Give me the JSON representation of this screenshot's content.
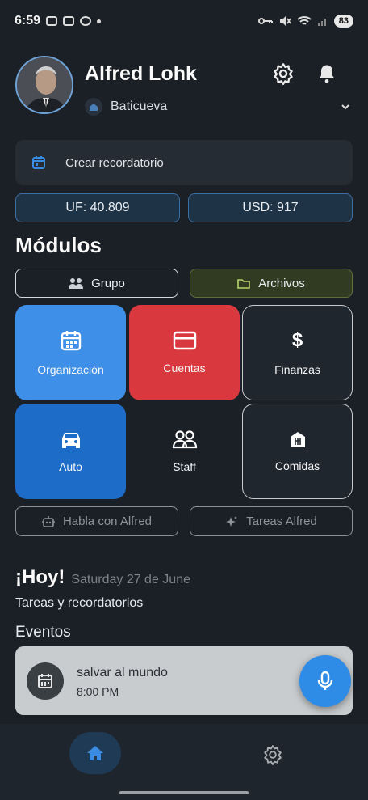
{
  "status_bar": {
    "time": "6:59",
    "battery": "83"
  },
  "profile": {
    "name": "Alfred Lohk",
    "location": "Baticueva"
  },
  "reminder": {
    "label": "Crear recordatorio"
  },
  "rates": {
    "uf": "UF: 40.809",
    "usd": "USD: 917"
  },
  "modules": {
    "title": "Módulos",
    "tabs": [
      {
        "label": "Grupo",
        "icon": "group-icon"
      },
      {
        "label": "Archivos",
        "icon": "folder-icon"
      }
    ],
    "tiles": [
      {
        "label": "Organización",
        "icon": "calendar-icon",
        "color": "#3d8fe8"
      },
      {
        "label": "Cuentas",
        "icon": "credit-card-icon",
        "color": "#d9393e"
      },
      {
        "label": "Finanzas",
        "icon": "dollar-icon",
        "color": "#20262d"
      },
      {
        "label": "Auto",
        "icon": "car-icon",
        "color": "#1d6cc8"
      },
      {
        "label": "Staff",
        "icon": "people-icon",
        "color": "#1b2026"
      },
      {
        "label": "Comidas",
        "icon": "restaurant-icon",
        "color": "#20262d"
      }
    ],
    "actions": [
      {
        "label": "Habla con Alfred",
        "icon": "robot-icon"
      },
      {
        "label": "Tareas Alfred",
        "icon": "sparkle-icon"
      }
    ]
  },
  "today": {
    "heading": "¡Hoy!",
    "date": "Saturday 27 de June",
    "tasks_label": "Tareas y recordatorios",
    "events_label": "Eventos",
    "events": [
      {
        "title": "salvar al mundo",
        "time": "8:00 PM"
      }
    ]
  },
  "colors": {
    "background": "#1b2026",
    "accent": "#2f8ce6",
    "danger": "#d9393e"
  }
}
